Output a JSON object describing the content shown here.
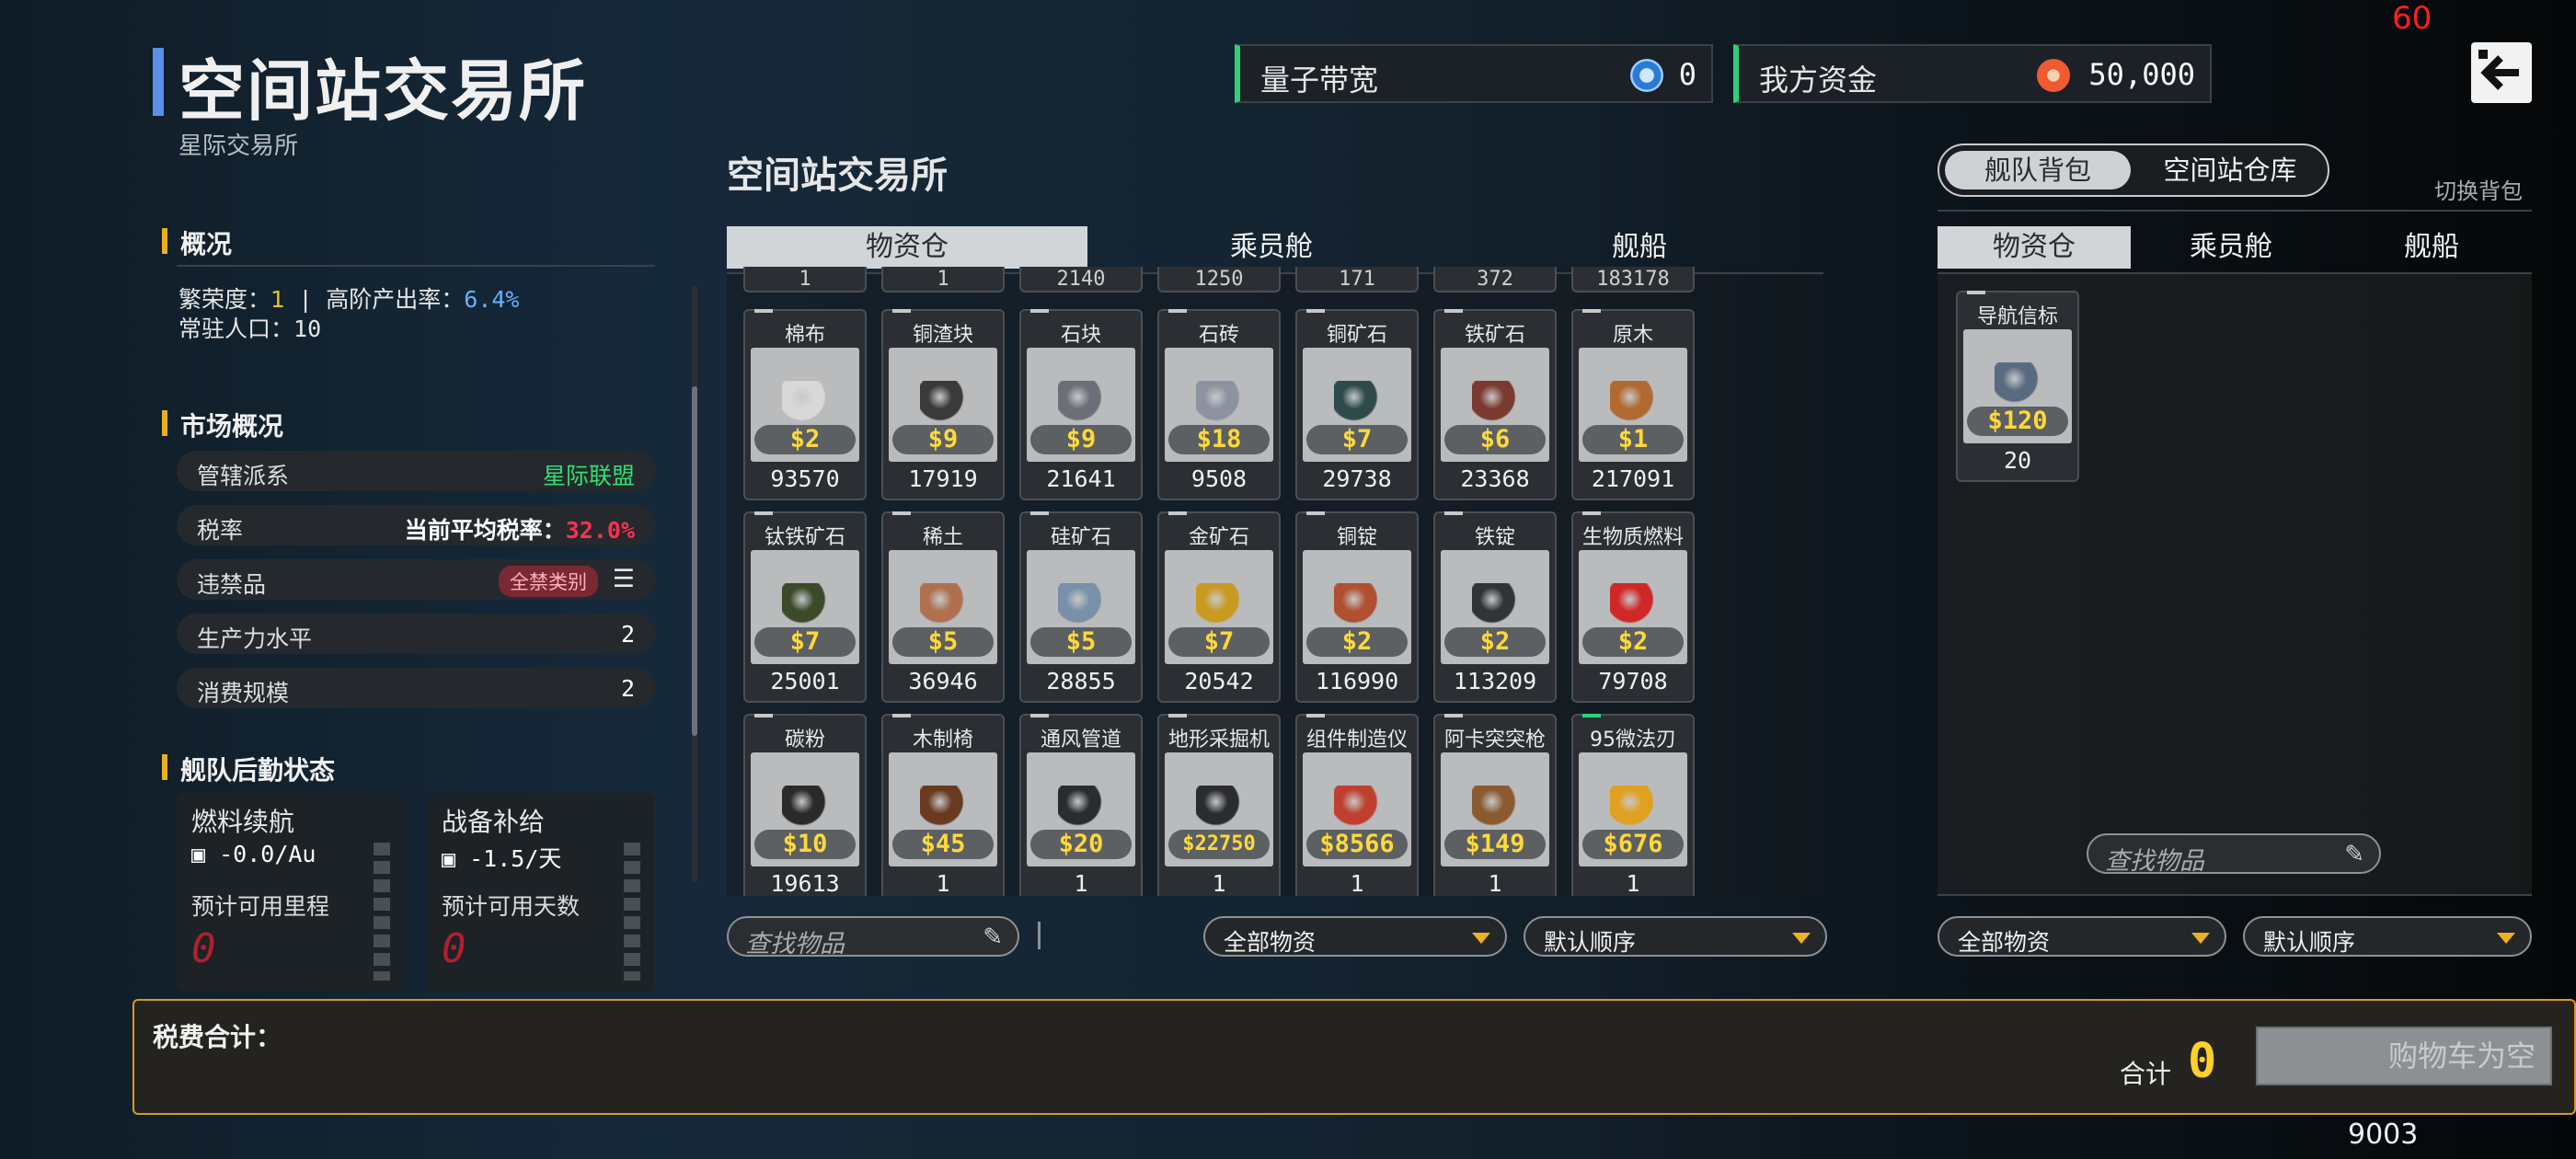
{
  "fps": "60",
  "header": {
    "title": "空间站交易所",
    "subtitle": "星际交易所",
    "bandwidth": {
      "label": "量子带宽",
      "value": "0",
      "icon": "quantum-icon"
    },
    "funds": {
      "label": "我方资金",
      "value": "50,000",
      "icon": "coin-icon"
    },
    "back_icon": "back-arrow-icon"
  },
  "overview": {
    "heading": "概况",
    "prosperity_label": "繁荣度：",
    "prosperity_value": "1",
    "separator": "|",
    "output_label": "高阶产出率：",
    "output_value": "6.4%",
    "population_label": "常驻人口：",
    "population_value": "10"
  },
  "market": {
    "heading": "市场概况",
    "rows": [
      {
        "key": "管辖派系",
        "value": "星际联盟"
      },
      {
        "key": "税率",
        "value_label": "当前平均税率：",
        "value": "32.0%"
      },
      {
        "key": "违禁品",
        "value": "全禁类别",
        "icon": "list-icon"
      },
      {
        "key": "生产力水平",
        "value": "2"
      },
      {
        "key": "消费规模",
        "value": "2"
      }
    ]
  },
  "logistics": {
    "heading": "舰队后勤状态",
    "fuel": {
      "title": "燃料续航",
      "rate": "-0.0/Au",
      "sub": "预计可用里程",
      "value": "0"
    },
    "supply": {
      "title": "战备补给",
      "rate": "-1.5/天",
      "sub": "预计可用天数",
      "value": "0"
    }
  },
  "station_panel": {
    "title": "空间站交易所",
    "tabs": [
      "物资仓",
      "乘员舱",
      "舰船"
    ],
    "active_tab": 0,
    "cut_row": [
      "1",
      "1",
      "2140",
      "1250",
      "171",
      "372",
      "183178"
    ],
    "items": [
      {
        "name": "棉布",
        "price": "$2",
        "qty": "93570",
        "icon": "cloth-icon",
        "color": "#d8d8d8"
      },
      {
        "name": "铜渣块",
        "price": "$9",
        "qty": "17919",
        "icon": "slag-icon",
        "color": "#3a3a3a"
      },
      {
        "name": "石块",
        "price": "$9",
        "qty": "21641",
        "icon": "stone-icon",
        "color": "#6b6f78"
      },
      {
        "name": "石砖",
        "price": "$18",
        "qty": "9508",
        "icon": "brick-icon",
        "color": "#8b93a0"
      },
      {
        "name": "铜矿石",
        "price": "$7",
        "qty": "29738",
        "icon": "copper-ore-icon",
        "color": "#2f4a4a"
      },
      {
        "name": "铁矿石",
        "price": "$6",
        "qty": "23368",
        "icon": "iron-ore-icon",
        "color": "#7a3a30"
      },
      {
        "name": "原木",
        "price": "$1",
        "qty": "217091",
        "icon": "log-icon",
        "color": "#b06a30"
      },
      {
        "name": "钛铁矿石",
        "price": "$7",
        "qty": "25001",
        "icon": "titanium-ore-icon",
        "color": "#3b4a28"
      },
      {
        "name": "稀土",
        "price": "$5",
        "qty": "36946",
        "icon": "rare-earth-icon",
        "color": "#b07050"
      },
      {
        "name": "硅矿石",
        "price": "$5",
        "qty": "28855",
        "icon": "silicon-ore-icon",
        "color": "#7890a8"
      },
      {
        "name": "金矿石",
        "price": "$7",
        "qty": "20542",
        "icon": "gold-ore-icon",
        "color": "#c89a20"
      },
      {
        "name": "铜锭",
        "price": "$2",
        "qty": "116990",
        "icon": "copper-ingot-icon",
        "color": "#b05030"
      },
      {
        "name": "铁锭",
        "price": "$2",
        "qty": "113209",
        "icon": "iron-ingot-icon",
        "color": "#303438"
      },
      {
        "name": "生物质燃料",
        "price": "$2",
        "qty": "79708",
        "icon": "biofuel-icon",
        "color": "#d02828"
      },
      {
        "name": "碳粉",
        "price": "$10",
        "qty": "19613",
        "icon": "carbon-icon",
        "color": "#2a2a2a"
      },
      {
        "name": "木制椅",
        "price": "$45",
        "qty": "1",
        "icon": "chair-icon",
        "color": "#6a3a20"
      },
      {
        "name": "通风管道",
        "price": "$20",
        "qty": "1",
        "icon": "vent-icon",
        "color": "#2a2c2e"
      },
      {
        "name": "地形采掘机",
        "price": "$22750",
        "qty": "1",
        "icon": "excavator-icon",
        "color": "#2a2c2e"
      },
      {
        "name": "组件制造仪",
        "price": "$8566",
        "qty": "1",
        "icon": "fabricator-icon",
        "color": "#c04030"
      },
      {
        "name": "阿卡突突枪",
        "price": "$149",
        "qty": "1",
        "icon": "rifle-icon",
        "color": "#8a5a30"
      },
      {
        "name": "95微法刃",
        "price": "$676",
        "qty": "1",
        "icon": "blade-icon",
        "color": "#e0a020"
      }
    ],
    "search_placeholder": "查找物品",
    "filter": "全部物资",
    "sort": "默认顺序"
  },
  "fleet_panel": {
    "toggle": [
      "舰队背包",
      "空间站仓库"
    ],
    "switch_label": "切换背包",
    "tabs": [
      "物资仓",
      "乘员舱",
      "舰船"
    ],
    "items": [
      {
        "name": "导航信标",
        "price": "$120",
        "qty": "20",
        "icon": "beacon-icon",
        "color": "#5a6a80"
      }
    ],
    "search_placeholder": "查找物品",
    "filter": "全部物资",
    "sort": "默认顺序"
  },
  "footer": {
    "tax_label": "税费合计：",
    "total_label": "合计",
    "total_value": "0",
    "cart_button": "购物车为空",
    "build": "9003"
  }
}
